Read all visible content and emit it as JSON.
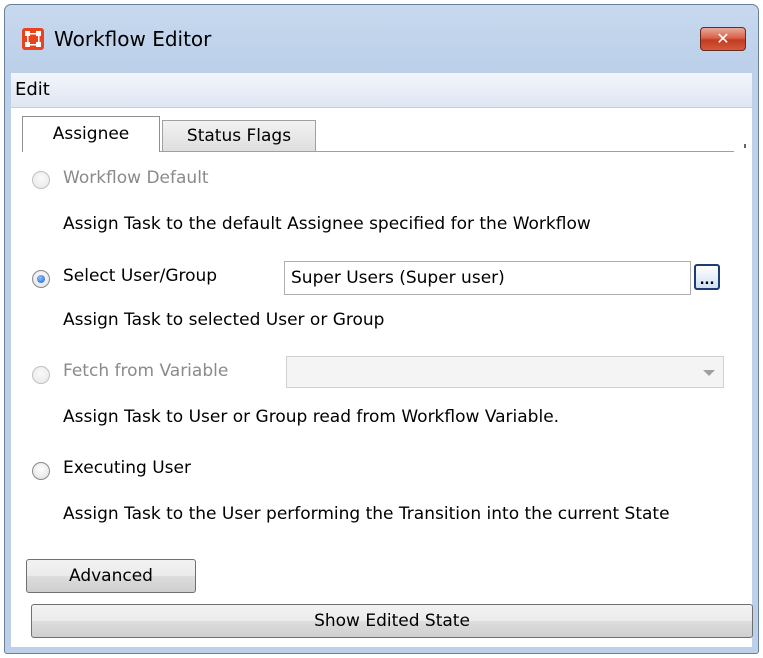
{
  "window": {
    "title": "Workflow Editor",
    "close_label": "✕"
  },
  "menubar": {
    "items": [
      "Edit"
    ]
  },
  "tabs": [
    {
      "label": "Assignee",
      "selected": true
    },
    {
      "label": "Status Flags",
      "selected": false
    }
  ],
  "assignee": {
    "options": [
      {
        "label": "Workflow Default",
        "checked": false,
        "enabled": false,
        "description": "Assign Task to the default Assignee specified for the Workflow"
      },
      {
        "label": "Select User/Group",
        "checked": true,
        "enabled": true,
        "description": "Assign Task to selected User or Group"
      },
      {
        "label": "Fetch from Variable",
        "checked": false,
        "enabled": false,
        "description": "Assign Task to User or Group read from Workflow Variable."
      },
      {
        "label": "Executing User",
        "checked": false,
        "enabled": true,
        "description": "Assign Task to the User performing the Transition into the current State"
      }
    ],
    "selected_user_group": "Super Users (Super user)",
    "browse_label": "...",
    "variable_select_value": ""
  },
  "buttons": {
    "advanced": "Advanced",
    "show_edited_state": "Show Edited State"
  }
}
